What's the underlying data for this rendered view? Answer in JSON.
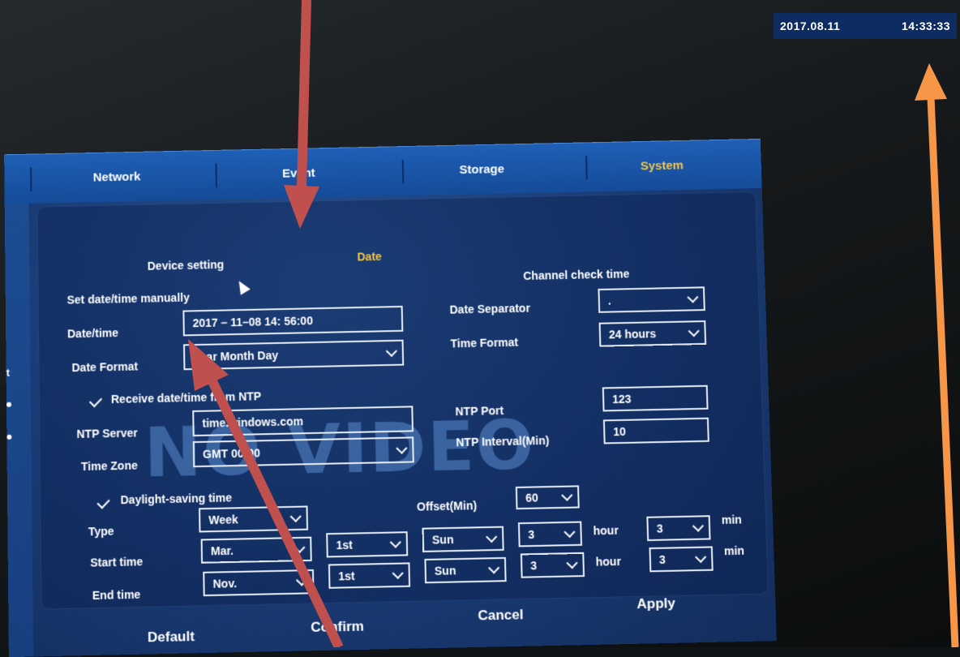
{
  "osd": {
    "date": "2017.08.11",
    "time": "14:33:33"
  },
  "tabs": [
    {
      "label": "Network",
      "active": false
    },
    {
      "label": "Event",
      "active": false
    },
    {
      "label": "Storage",
      "active": false
    },
    {
      "label": "System",
      "active": true
    }
  ],
  "left_partial": {
    "label": "t"
  },
  "section": {
    "device_setting_label": "Device setting",
    "date_label": "Date",
    "channel_check_time_label": "Channel check time"
  },
  "manual": {
    "title": "Set date/time manually",
    "datetime_label": "Date/time",
    "datetime_value": "2017 – 11–08    14: 56:00",
    "date_format_label": "Date Format",
    "date_format_value": "Year Month Day",
    "date_separator_label": "Date Separator",
    "date_separator_value": ".",
    "time_format_label": "Time Format",
    "time_format_value": "24 hours"
  },
  "ntp": {
    "enabled_label": "Receive date/time from NTP",
    "server_label": "NTP Server",
    "server_value": "time.windows.com",
    "timezone_label": "Time Zone",
    "timezone_value": "GMT 00:00",
    "port_label": "NTP Port",
    "port_value": "123",
    "interval_label": "NTP Interval(Min)",
    "interval_value": "10"
  },
  "dst": {
    "enabled_label": "Daylight-saving time",
    "type_label": "Type",
    "type_value": "Week",
    "offset_label": "Offset(Min)",
    "offset_value": "60",
    "start_label": "Start time",
    "start_month": "Mar.",
    "start_week": "1st",
    "start_day": "Sun",
    "start_hour": "3",
    "start_min": "3",
    "end_label": "End time",
    "end_month": "Nov.",
    "end_week": "1st",
    "end_day": "Sun",
    "end_hour": "3",
    "end_min": "3",
    "hour_unit": "hour",
    "min_unit": "min"
  },
  "watermark": "NO VIDEO",
  "buttons": {
    "default": "Default",
    "confirm": "Confirm",
    "cancel": "Cancel",
    "apply": "Apply"
  },
  "colors": {
    "active_tab": "#f5c54a",
    "tabbar": "#1e5fb6",
    "panel": "#193a73",
    "arrow_red": "#c0504d",
    "arrow_orange": "#f79646"
  }
}
